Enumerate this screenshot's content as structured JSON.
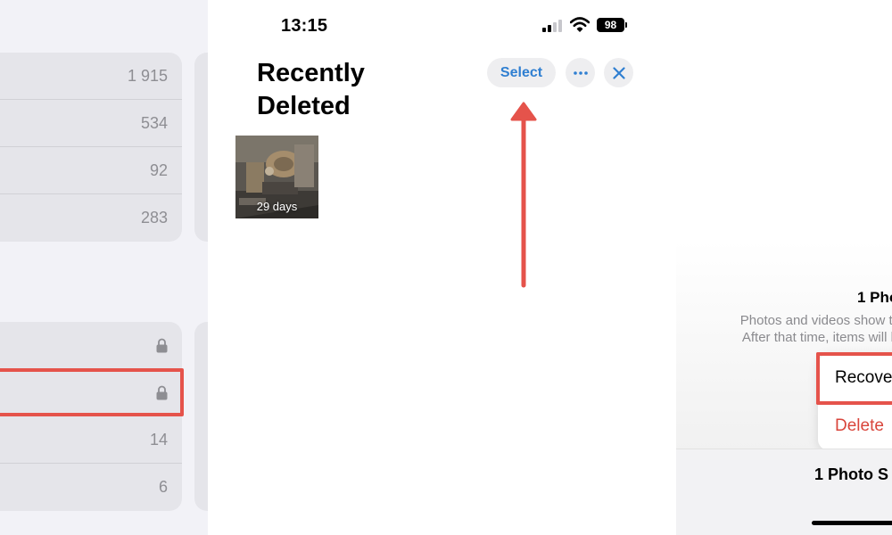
{
  "left": {
    "group1": [
      {
        "count": "1 915"
      },
      {
        "count": "534"
      },
      {
        "count": "92"
      },
      {
        "count": "283"
      }
    ],
    "group2": [
      {
        "icon": "lock-icon"
      },
      {
        "icon": "lock-icon"
      },
      {
        "count": "14"
      },
      {
        "count": "6"
      }
    ]
  },
  "middle": {
    "status": {
      "time": "13:15",
      "battery": "98"
    },
    "title": "Recently Deleted",
    "select_label": "Select",
    "more_icon": "ellipsis-icon",
    "close_icon": "close-icon",
    "thumbnail": {
      "label": "29 days"
    }
  },
  "right": {
    "sheet_title": "1 Pho",
    "description_line1": "Photos and videos show the da",
    "description_line2": "After that time, items will be pe",
    "menu": {
      "recover": "Recove",
      "delete": "Delete"
    },
    "bottom_title": "1 Photo S"
  },
  "colors": {
    "highlight": "#e5534b",
    "accent_blue": "#2f7fd1",
    "destructive_red": "#d9453b"
  }
}
